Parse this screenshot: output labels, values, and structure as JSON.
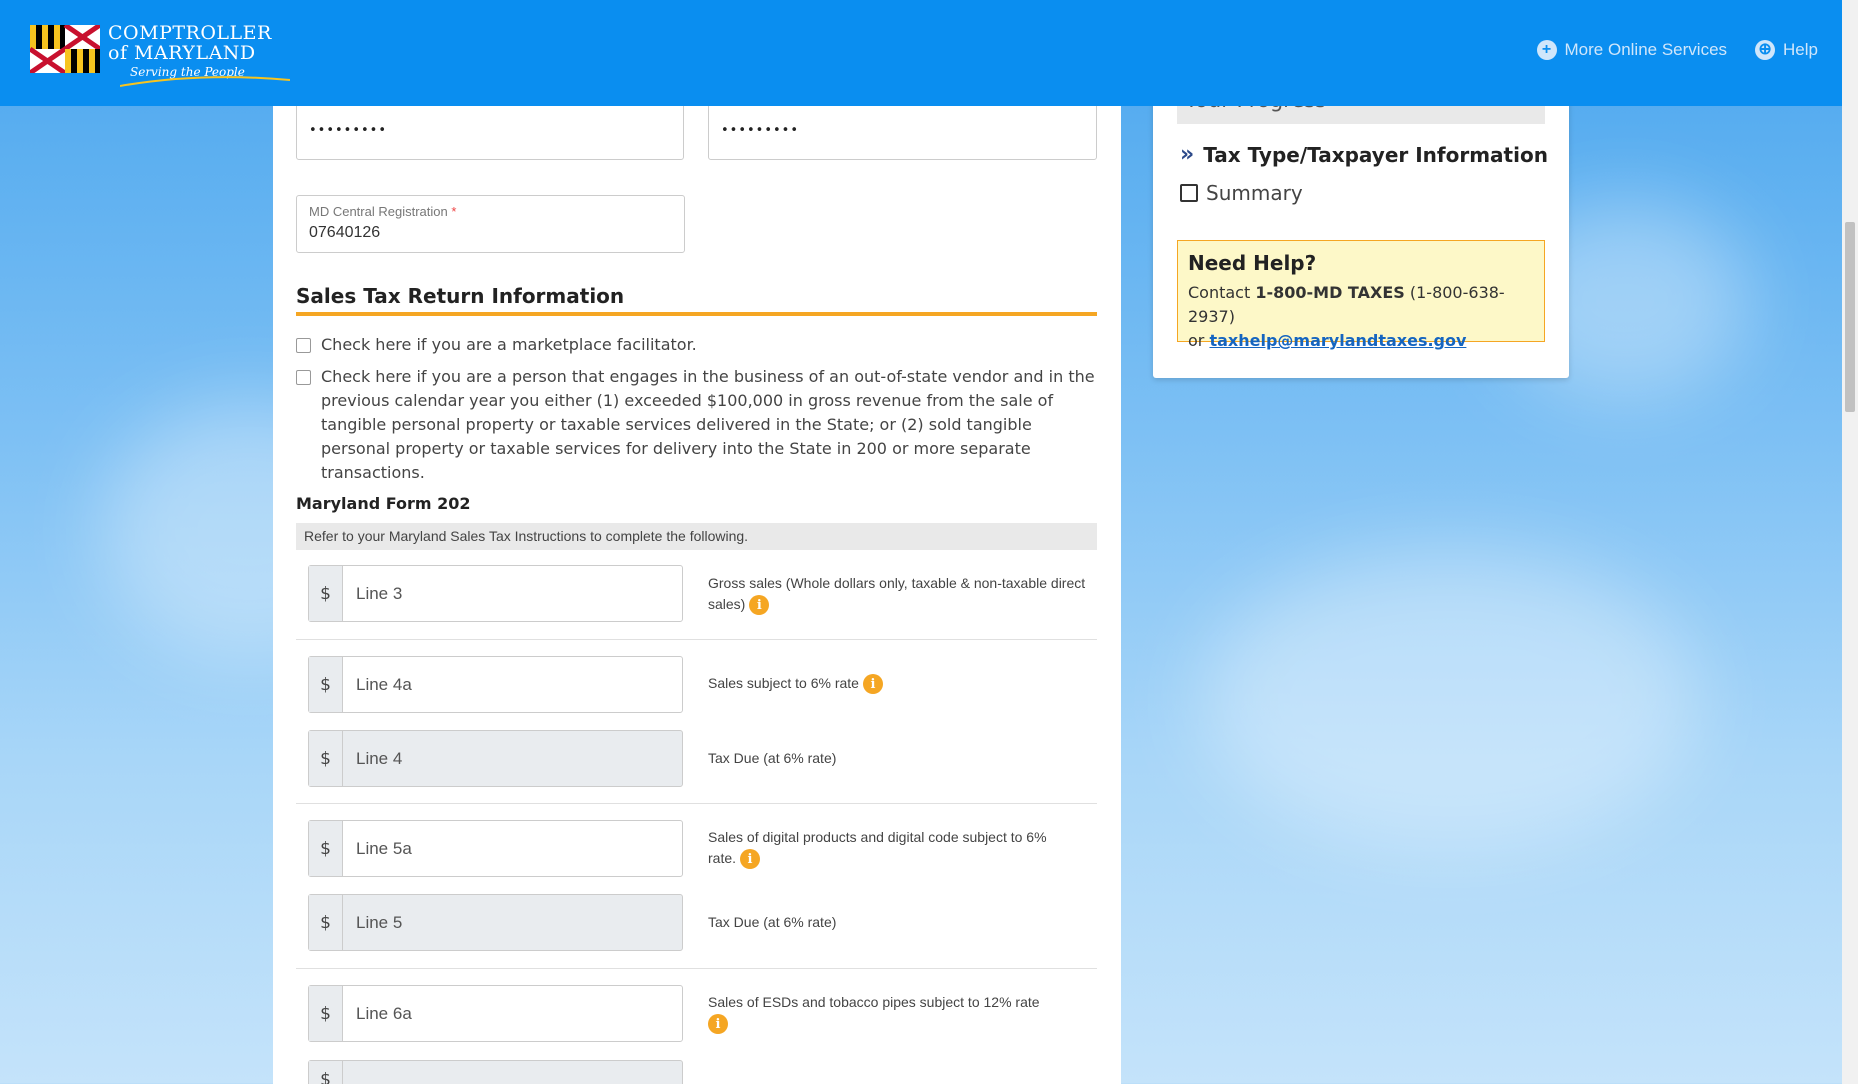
{
  "header": {
    "logo": {
      "line1": "COMPTROLLER",
      "line2": "of MARYLAND",
      "tagline": "Serving the People"
    },
    "nav": [
      {
        "label": "More Online Services",
        "icon": "plus-circle-icon"
      },
      {
        "label": "Help",
        "icon": "lifebuoy-icon"
      }
    ]
  },
  "credentials": {
    "password_mask": "•••••••••",
    "confirm_mask": "•••••••••"
  },
  "registration": {
    "label": "MD Central Registration",
    "required_mark": "*",
    "value": "07640126"
  },
  "sales_tax": {
    "title": "Sales Tax Return Information",
    "checkbox_marketplace": "Check here if you are a marketplace facilitator.",
    "checkbox_vendor": "Check here if you are a person that engages in the business of an out-of-state vendor and in the previous calendar year you either (1) exceeded $100,000 in gross revenue from the sale of tangible personal property or taxable services delivered in the State; or (2) sold tangible personal property or taxable services for delivery into the State in 200 or more separate transactions."
  },
  "form202": {
    "title": "Maryland Form 202",
    "instructions": "Refer to your Maryland Sales Tax Instructions to complete the following.",
    "currency": "$",
    "lines": [
      {
        "placeholder": "Line 3",
        "desc": "Gross sales (Whole dollars only, taxable & non-taxable direct sales)",
        "info": true,
        "readonly": false
      },
      {
        "placeholder": "Line 4a",
        "desc": "Sales subject to 6% rate",
        "info": true,
        "readonly": false
      },
      {
        "placeholder": "Line 4",
        "desc": "Tax Due (at 6% rate)",
        "info": false,
        "readonly": true
      },
      {
        "placeholder": "Line 5a",
        "desc": "Sales of digital products and digital code subject to 6% rate.",
        "info": true,
        "readonly": false
      },
      {
        "placeholder": "Line 5",
        "desc": "Tax Due (at 6% rate)",
        "info": false,
        "readonly": true
      },
      {
        "placeholder": "Line 6a",
        "desc": "Sales of ESDs and tobacco pipes subject to 12% rate",
        "info": true,
        "readonly": false
      }
    ]
  },
  "sidebar": {
    "progress_title": "Your Progress",
    "steps": [
      {
        "label": "Tax Type/Taxpayer Information",
        "state": "current"
      },
      {
        "label": "Summary",
        "state": "pending"
      }
    ],
    "help": {
      "title": "Need Help?",
      "contact_prefix": "Contact",
      "phone_bold": "1-800-MD TAXES",
      "phone_num": "(1-800-638-2937)",
      "or": "or",
      "email": "taxhelp@marylandtaxes.gov"
    }
  },
  "colors": {
    "header_bg": "#0a8ef0",
    "accent": "#f5a623",
    "link": "#1565c0"
  }
}
